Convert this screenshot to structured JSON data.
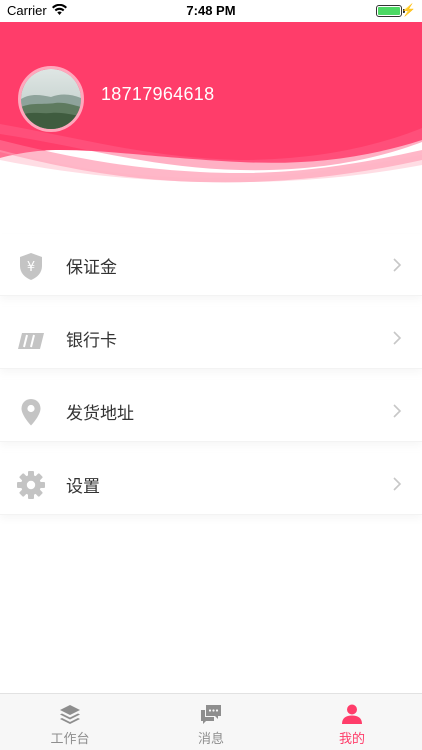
{
  "status_bar": {
    "carrier": "Carrier",
    "time": "7:48 PM",
    "battery_level": 1.0
  },
  "profile": {
    "phone": "18717964618"
  },
  "menu": [
    {
      "label": "保证金",
      "icon": "deposit-shield-yen-icon"
    },
    {
      "label": "银行卡",
      "icon": "bank-card-icon"
    },
    {
      "label": "发货地址",
      "icon": "location-pin-icon"
    },
    {
      "label": "设置",
      "icon": "gear-icon"
    }
  ],
  "tabbar": {
    "tabs": [
      {
        "label": "工作台",
        "icon": "layers-icon",
        "active": false
      },
      {
        "label": "消息",
        "icon": "chat-bubbles-icon",
        "active": false
      },
      {
        "label": "我的",
        "icon": "user-icon",
        "active": true
      }
    ]
  },
  "colors": {
    "accent": "#ff3d6a",
    "icon_gray": "#c4c4c4",
    "text": "#333333",
    "tab_inactive": "#8e8e8e"
  }
}
